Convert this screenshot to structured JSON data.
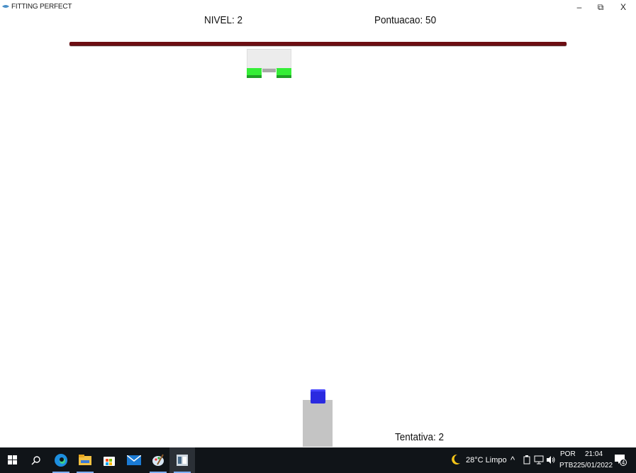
{
  "window": {
    "title": "FITTING PERFECT",
    "controls": {
      "minimize": "–",
      "maximize": "⧉",
      "close": "X"
    }
  },
  "hud": {
    "level_label": "NIVEL:  2",
    "score_label": "Pontuacao:  50",
    "attempt_label": "Tentativa:  2"
  },
  "colors": {
    "ceiling": "#6d0d12",
    "target_body": "#ececec",
    "target_legs": "#35ee37",
    "player_block": "#2a2ae0",
    "launcher": "#c4c4c4",
    "taskbar": "#101418"
  },
  "taskbar": {
    "apps": [
      "windows-start",
      "search",
      "edge",
      "file-explorer",
      "microsoft-store",
      "mail",
      "paint",
      "game-window"
    ],
    "weather": "28°C  Limpo",
    "language": "POR",
    "keyboard": "PTB2",
    "time": "21:04",
    "date": "25/01/2022",
    "notifications": "4"
  }
}
